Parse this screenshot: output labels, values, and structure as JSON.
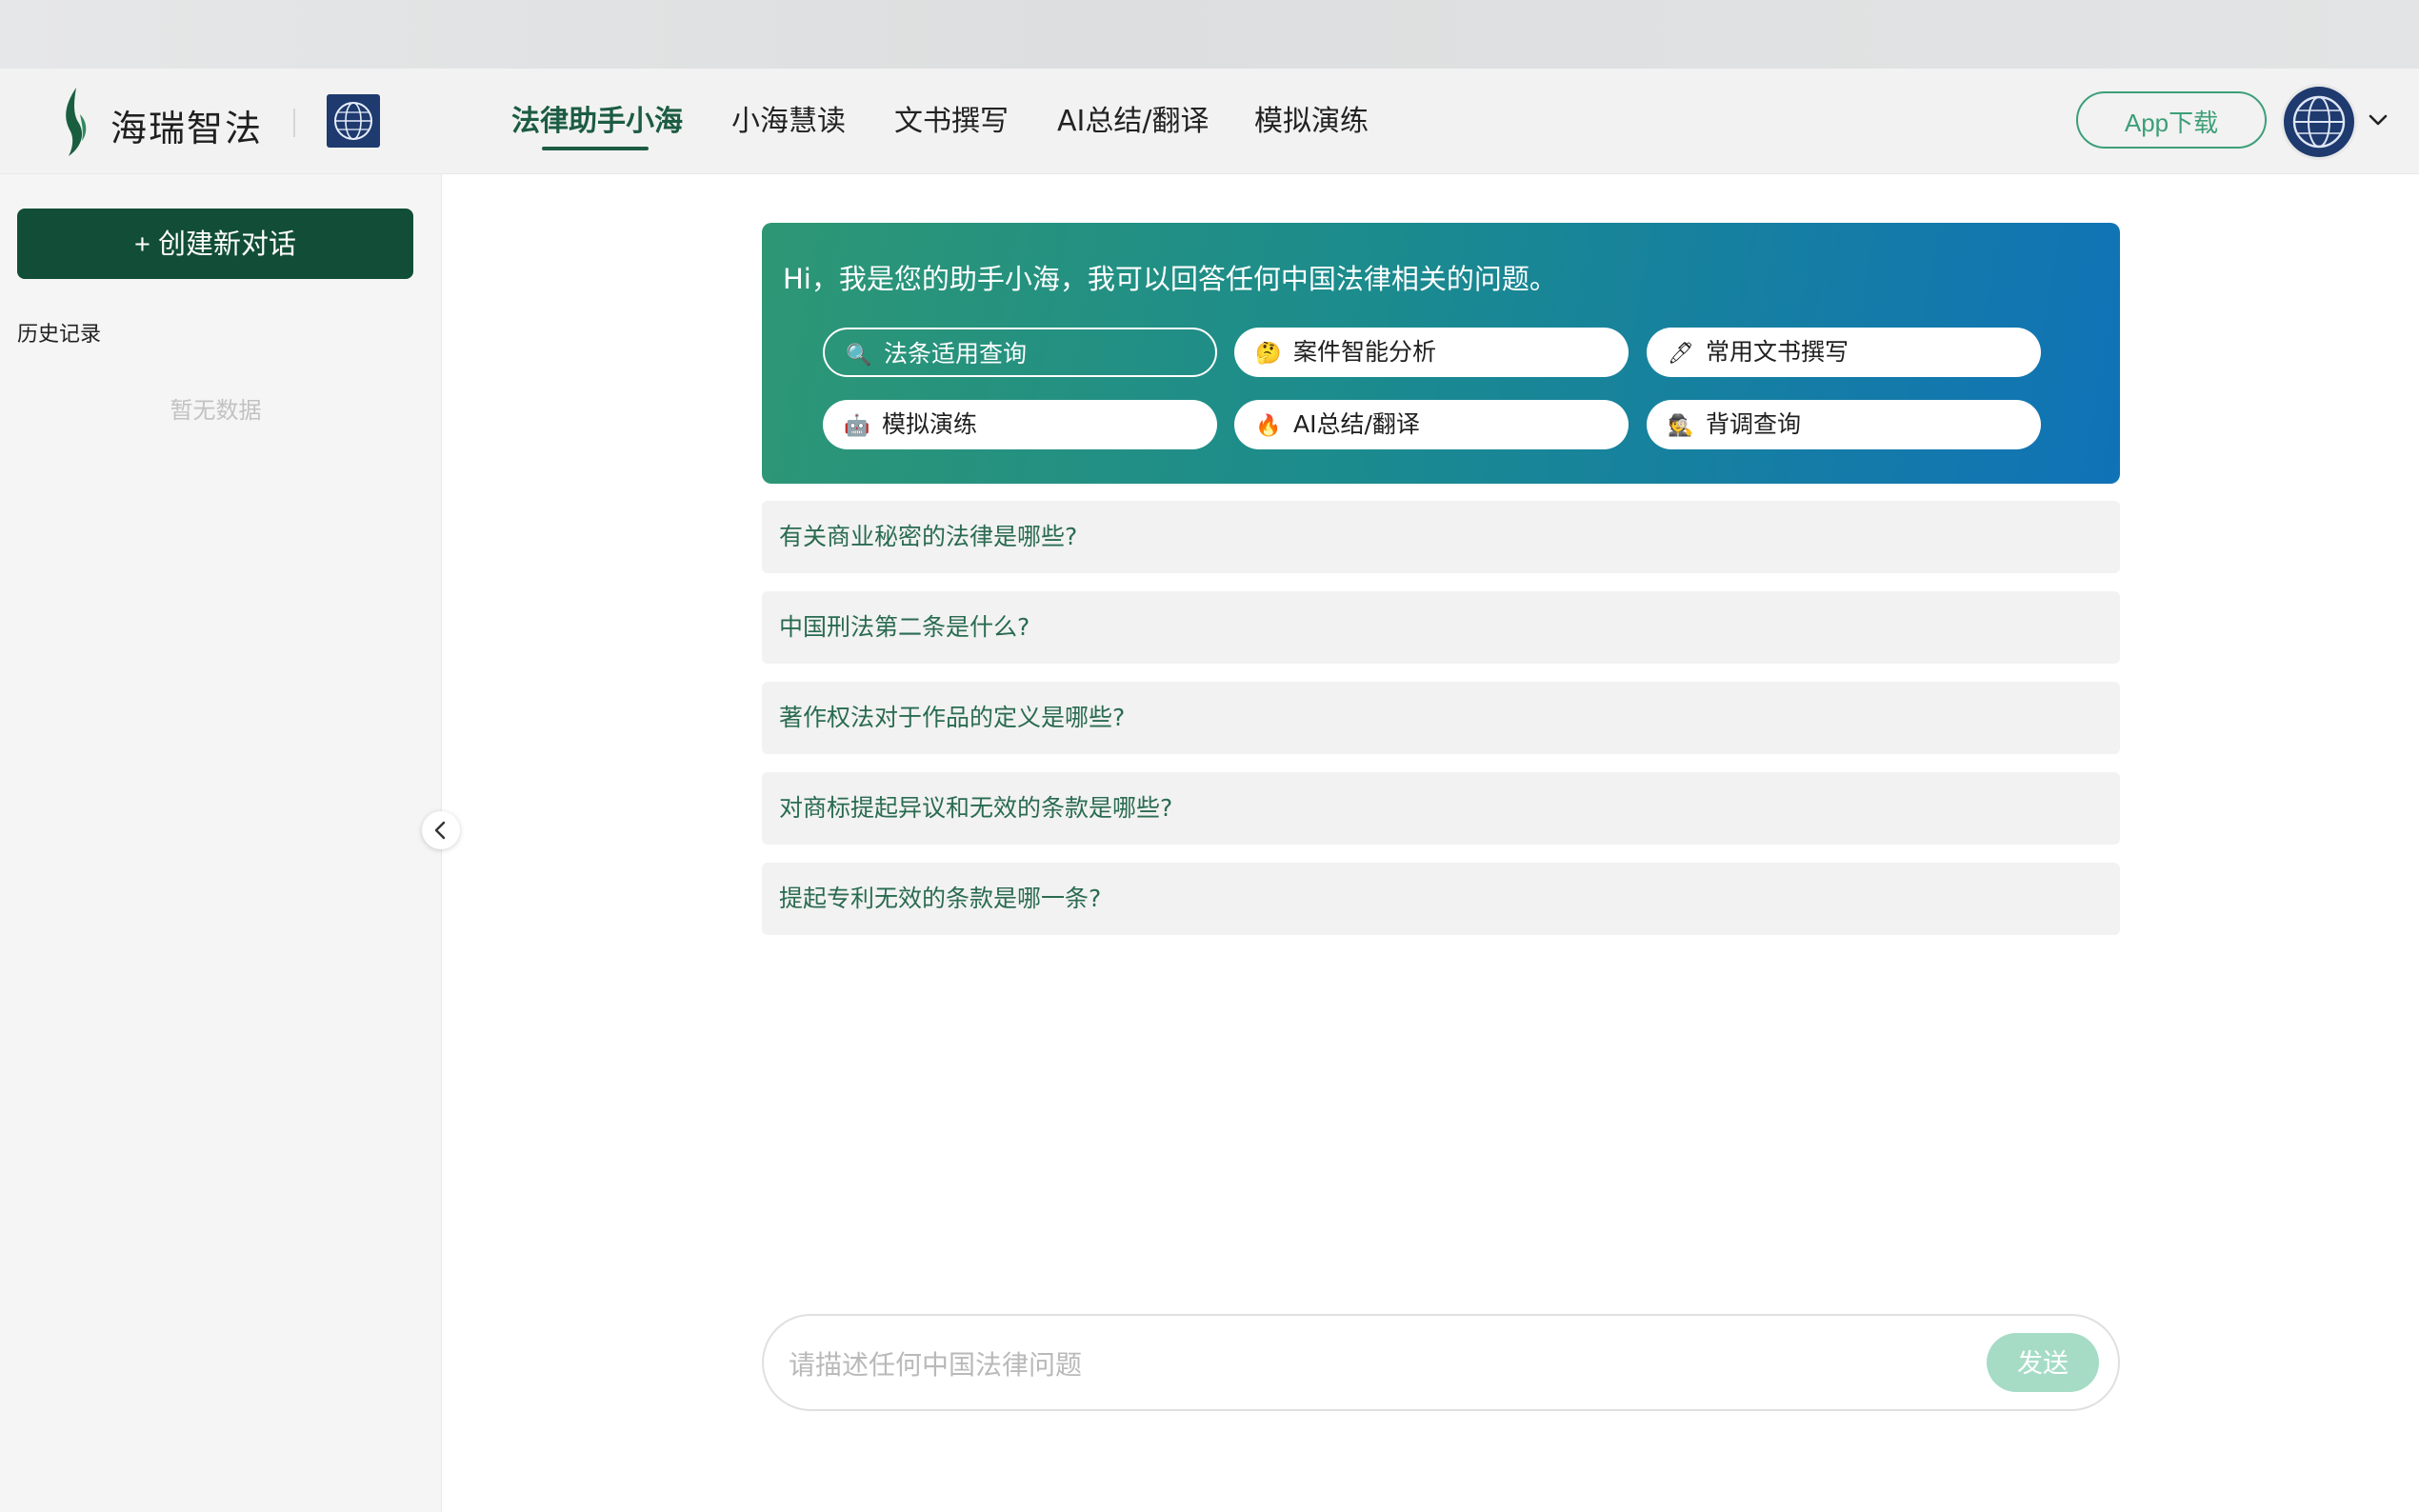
{
  "brand": {
    "name": "海瑞智法",
    "logo_icon": "flame-leaf-logo",
    "badge_icon": "globe-emblem-icon"
  },
  "nav": {
    "items": [
      {
        "label": "法律助手小海",
        "active": true
      },
      {
        "label": "小海慧读",
        "active": false
      },
      {
        "label": "文书撰写",
        "active": false
      },
      {
        "label": "AI总结/翻译",
        "active": false
      },
      {
        "label": "模拟演练",
        "active": false
      }
    ],
    "accent_color": "#1c5c43"
  },
  "header": {
    "app_download_label": "App下载",
    "avatar_icon": "globe-emblem-icon",
    "caret_icon": "chevron-down-icon"
  },
  "sidebar": {
    "new_chat_label": "+ 创建新对话",
    "history_title": "历史记录",
    "empty_text": "暂无数据",
    "collapse_icon": "chevron-left-icon"
  },
  "banner": {
    "greeting": "Hi，我是您的助手小海，我可以回答任何中国法律相关的问题。",
    "chips": [
      {
        "icon": "magnifier",
        "glyph": "🔍",
        "label": "法条适用查询",
        "selected": true
      },
      {
        "icon": "thinking-face",
        "glyph": "🤔",
        "label": "案件智能分析",
        "selected": false
      },
      {
        "icon": "pen",
        "glyph": "🖊",
        "label": "常用文书撰写",
        "selected": false
      },
      {
        "icon": "robot",
        "glyph": "🤖",
        "label": "模拟演练",
        "selected": false
      },
      {
        "icon": "fire",
        "glyph": "🔥",
        "label": "AI总结/翻译",
        "selected": false
      },
      {
        "icon": "detective",
        "glyph": "🕵",
        "label": "背调查询",
        "selected": false
      }
    ],
    "gradient": [
      "#2d9774",
      "#1072b7"
    ]
  },
  "suggestions": [
    "有关商业秘密的法律是哪些?",
    "中国刑法第二条是什么?",
    "著作权法对于作品的定义是哪些?",
    "对商标提起异议和无效的条款是哪些?",
    "提起专利无效的条款是哪一条?"
  ],
  "composer": {
    "placeholder": "请描述任何中国法律问题",
    "value": "",
    "send_label": "发送",
    "send_color": "#a6dcc6"
  }
}
